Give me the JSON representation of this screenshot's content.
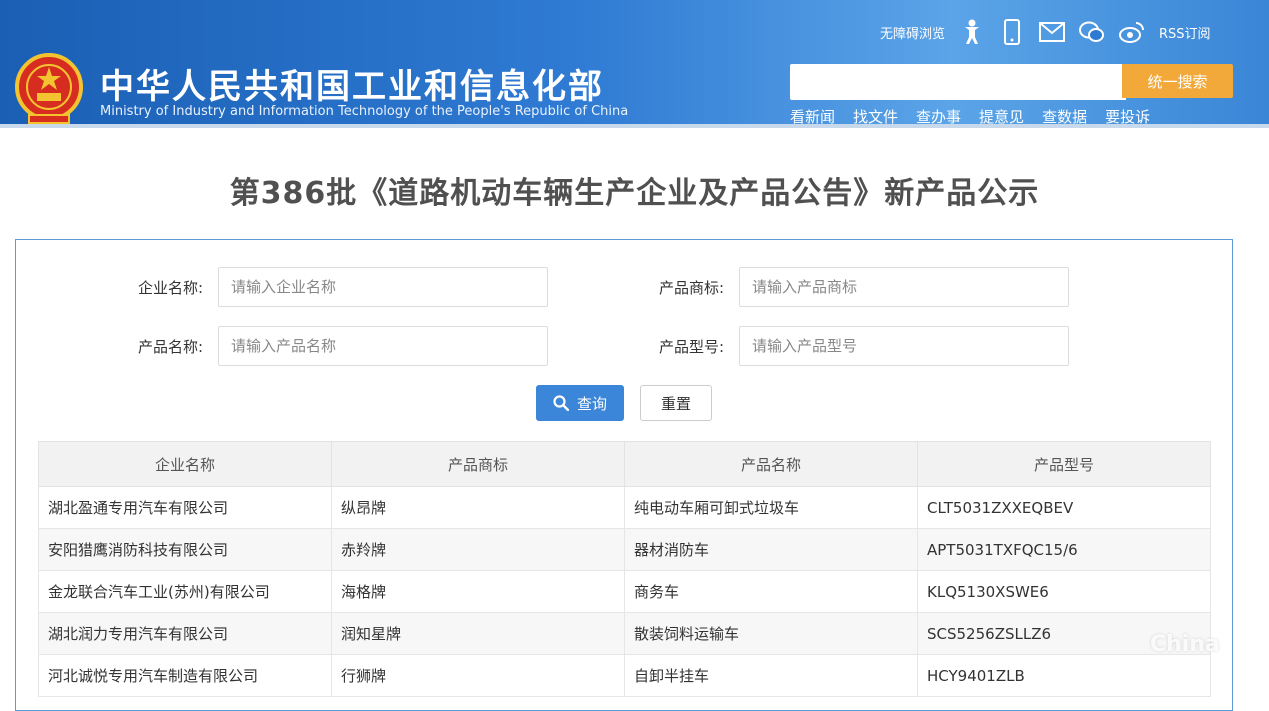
{
  "header": {
    "title_cn": "中华人民共和国工业和信息化部",
    "title_en": "Ministry of Industry and Information Technology of the People's Republic of China",
    "accessibility": "无障碍浏览",
    "rss": "RSS订阅",
    "search_button": "统一搜索",
    "search_placeholder": "",
    "nav": [
      "看新闻",
      "找文件",
      "查办事",
      "提意见",
      "查数据",
      "要投诉"
    ]
  },
  "page": {
    "title": "第386批《道路机动车辆生产企业及产品公告》新产品公示"
  },
  "form": {
    "company_label": "企业名称:",
    "company_placeholder": "请输入企业名称",
    "brand_label": "产品商标:",
    "brand_placeholder": "请输入产品商标",
    "product_label": "产品名称:",
    "product_placeholder": "请输入产品名称",
    "model_label": "产品型号:",
    "model_placeholder": "请输入产品型号",
    "query_button": "查询",
    "reset_button": "重置"
  },
  "table": {
    "headers": [
      "企业名称",
      "产品商标",
      "产品名称",
      "产品型号"
    ],
    "rows": [
      [
        "湖北盈通专用汽车有限公司",
        "纵昂牌",
        "纯电动车厢可卸式垃圾车",
        "CLT5031ZXXEQBEV"
      ],
      [
        "安阳猎鹰消防科技有限公司",
        "赤羚牌",
        "器材消防车",
        "APT5031TXFQC15/6"
      ],
      [
        "金龙联合汽车工业(苏州)有限公司",
        "海格牌",
        "商务车",
        "KLQ5130XSWE6"
      ],
      [
        "湖北润力专用汽车有限公司",
        "润知星牌",
        "散装饲料运输车",
        "SCS5256ZSLLZ6"
      ],
      [
        "河北诚悦专用汽车制造有限公司",
        "行狮牌",
        "自卸半挂车",
        "HCY9401ZLB"
      ]
    ]
  },
  "watermark": "China",
  "colors": {
    "header_blue": "#2f7ad3",
    "search_orange": "#f2a93a",
    "query_blue": "#3b86d8",
    "panel_border": "#5b9bd5"
  }
}
